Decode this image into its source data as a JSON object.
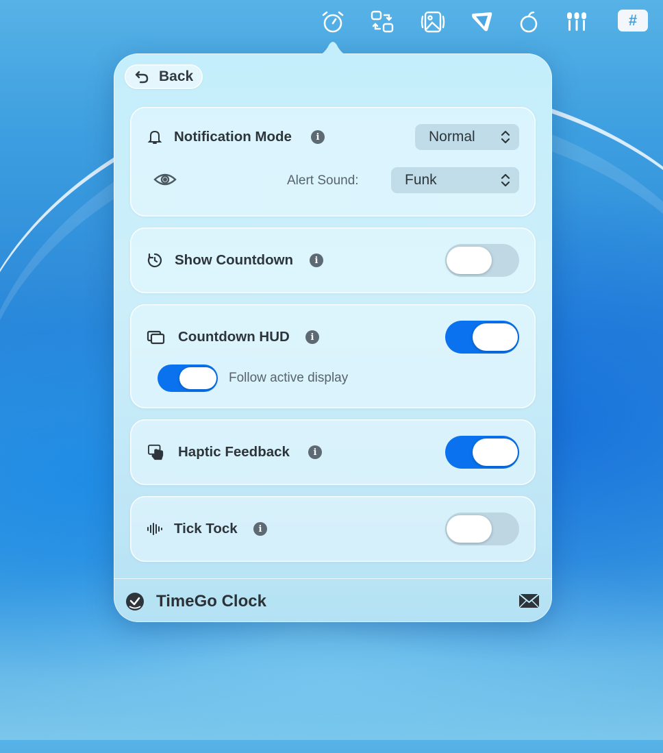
{
  "menubar": {
    "icons": [
      "alarm-clock-icon",
      "convert-icon",
      "photo-icon",
      "pen-tool-icon",
      "timer-apple-icon",
      "brushes-icon",
      "hashtag-icon"
    ],
    "hashtag_symbol": "#"
  },
  "popover": {
    "back_label": "Back",
    "notification": {
      "title": "Notification Mode",
      "mode_value": "Normal",
      "alert_sound_label": "Alert Sound:",
      "alert_sound_value": "Funk"
    },
    "show_countdown": {
      "title": "Show Countdown",
      "enabled": false
    },
    "countdown_hud": {
      "title": "Countdown HUD",
      "enabled": true,
      "follow_label": "Follow active display",
      "follow_enabled": true
    },
    "haptic_feedback": {
      "title": "Haptic Feedback",
      "enabled": true
    },
    "tick_tock": {
      "title": "Tick Tock",
      "enabled": false
    },
    "footer": {
      "app_name": "TimeGo Clock"
    }
  },
  "colors": {
    "accent": "#0a72ee",
    "text": "#2d353b"
  }
}
